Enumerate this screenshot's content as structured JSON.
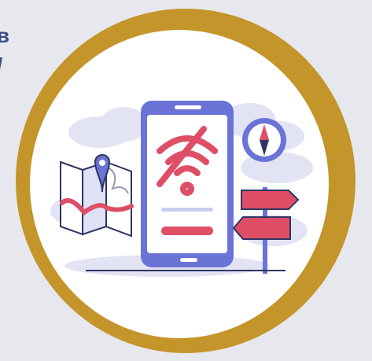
{
  "edge_fragments": [
    "в",
    "/"
  ],
  "illustration": {
    "subject": "no-connection-offline-navigation",
    "icons": [
      "map-icon",
      "location-pin-icon",
      "phone-icon",
      "no-wifi-icon",
      "compass-icon",
      "signpost-icon",
      "cloud-icon"
    ]
  },
  "colors": {
    "page_background": "#e7e8ee",
    "ring": "#c4952a",
    "badge_fill": "#ffffff",
    "accent_red": "#de4e66",
    "accent_blue": "#6b73d6",
    "cloud": "#e2e3f3",
    "outline": "#2f3563"
  }
}
